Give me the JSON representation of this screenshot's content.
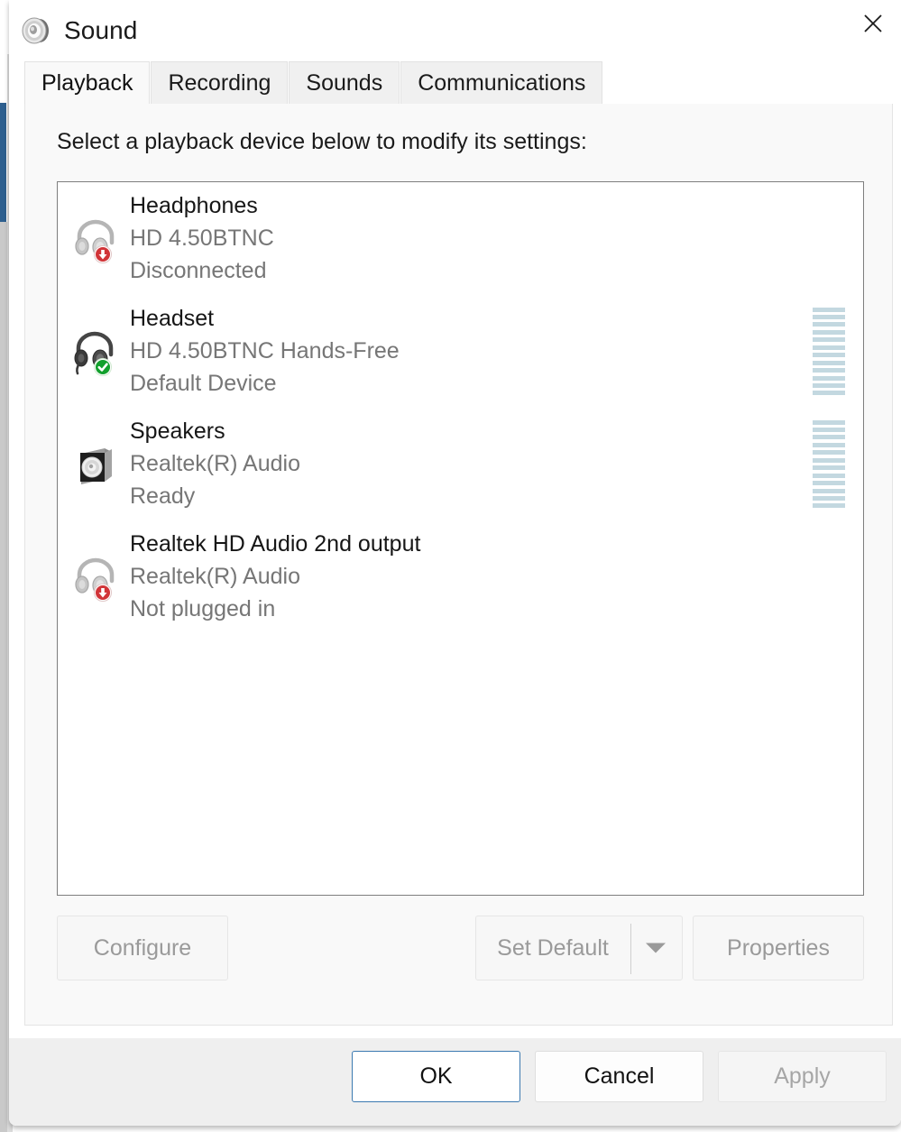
{
  "window": {
    "title": "Sound",
    "icon": "speaker-icon",
    "close_label": "✕"
  },
  "tabs": [
    {
      "label": "Playback",
      "active": true
    },
    {
      "label": "Recording",
      "active": false
    },
    {
      "label": "Sounds",
      "active": false
    },
    {
      "label": "Communications",
      "active": false
    }
  ],
  "playback": {
    "instruction": "Select a playback device below to modify its settings:",
    "devices": [
      {
        "name": "Headphones",
        "description": "HD 4.50BTNC",
        "status": "Disconnected",
        "icon": "headphones-icon",
        "badge": "red-down-arrow-badge",
        "meter": false
      },
      {
        "name": "Headset",
        "description": "HD 4.50BTNC Hands-Free",
        "status": "Default Device",
        "icon": "headset-icon",
        "badge": "green-check-badge",
        "meter": true
      },
      {
        "name": "Speakers",
        "description": "Realtek(R) Audio",
        "status": "Ready",
        "icon": "speaker-box-icon",
        "badge": "none",
        "meter": true
      },
      {
        "name": "Realtek HD Audio 2nd output",
        "description": "Realtek(R) Audio",
        "status": "Not plugged in",
        "icon": "headphones-icon",
        "badge": "red-down-arrow-badge",
        "meter": false
      }
    ],
    "buttons": {
      "configure": "Configure",
      "set_default": "Set Default",
      "properties": "Properties"
    }
  },
  "footer": {
    "ok": "OK",
    "cancel": "Cancel",
    "apply": "Apply"
  },
  "colors": {
    "accent_focus": "#3b79b0",
    "meter_segment": "#c3d8e0",
    "badge_red": "#d13438",
    "badge_green": "#12a02c",
    "text_primary": "#161616",
    "text_secondary": "#767676",
    "text_disabled": "#9a9a9a"
  }
}
